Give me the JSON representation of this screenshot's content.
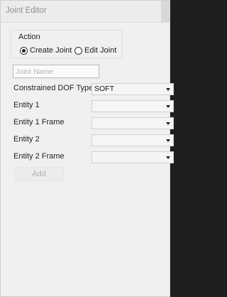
{
  "window": {
    "title": "Joint Editor"
  },
  "action": {
    "label": "Action",
    "options": [
      {
        "label": "Create Joint",
        "selected": true
      },
      {
        "label": "Edit Joint",
        "selected": false
      }
    ]
  },
  "joint_name": {
    "placeholder": "Joint Name",
    "value": ""
  },
  "fields": [
    {
      "label": "Constrained DOF Type",
      "value": "SOFT"
    },
    {
      "label": "Entity 1",
      "value": ""
    },
    {
      "label": "Entity 1 Frame",
      "value": ""
    },
    {
      "label": "Entity 2",
      "value": ""
    },
    {
      "label": "Entity 2 Frame",
      "value": ""
    }
  ],
  "add_button": {
    "label": "Add",
    "enabled": false
  }
}
